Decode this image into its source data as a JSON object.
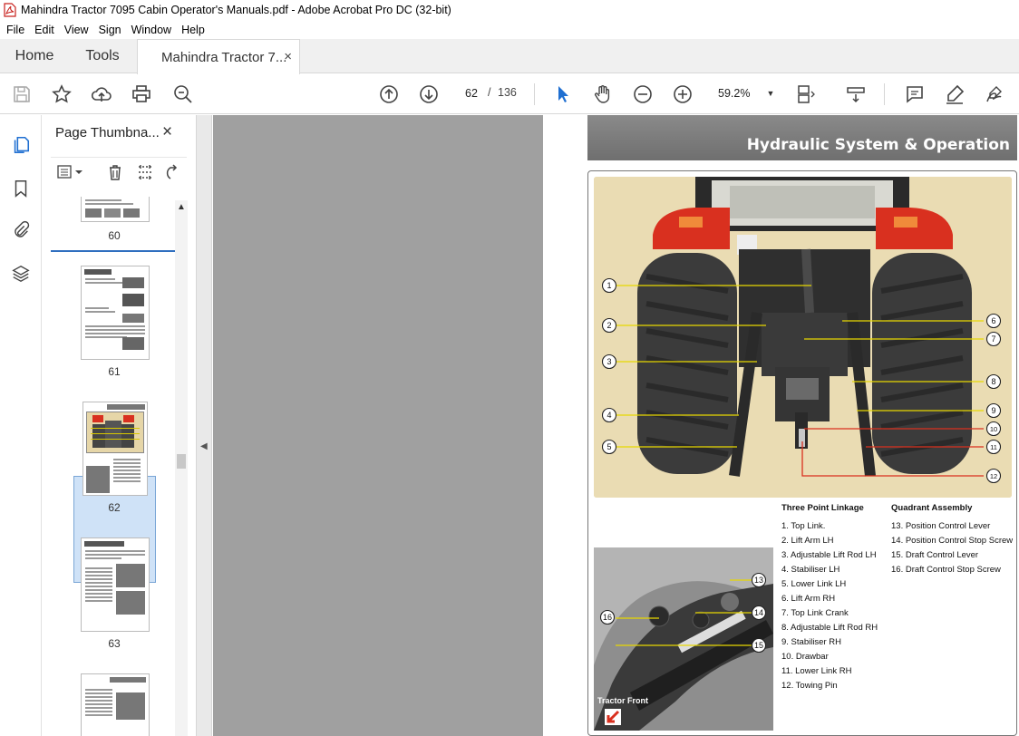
{
  "window": {
    "title": "Mahindra Tractor 7095 Cabin Operator's Manuals.pdf - Adobe Acrobat Pro DC (32-bit)"
  },
  "menu": [
    "File",
    "Edit",
    "View",
    "Sign",
    "Window",
    "Help"
  ],
  "tabs": {
    "home": "Home",
    "tools": "Tools",
    "document": "Mahindra Tractor 7...",
    "close_glyph": "×"
  },
  "toolbar": {
    "current_page": "62",
    "page_sep": "/",
    "total_pages": "136",
    "zoom": "59.2%",
    "icons": [
      "save-icon",
      "star-icon",
      "upload-icon",
      "print-icon",
      "search-zoom-icon",
      "page-up-icon",
      "page-down-icon",
      "select-cursor-icon",
      "hand-icon",
      "zoom-out-icon",
      "zoom-in-icon",
      "fit-width-icon",
      "scroll-mode-icon",
      "comment-icon",
      "highlight-pen-icon",
      "sign-icon"
    ]
  },
  "thumbnail_panel": {
    "title": "Page Thumbna...",
    "close_glyph": "×",
    "thumbnails": [
      {
        "label": "60"
      },
      {
        "label": "61"
      },
      {
        "label": "62",
        "selected": true
      },
      {
        "label": "63"
      },
      {
        "label": ""
      }
    ]
  },
  "page": {
    "header": "Hydraulic System & Operation",
    "callouts_main": [
      "1",
      "2",
      "3",
      "4",
      "5",
      "6",
      "7",
      "8",
      "9",
      "10",
      "11",
      "12"
    ],
    "callouts_lower": [
      "13",
      "14",
      "15",
      "16"
    ],
    "lower_image_caption": "Tractor Front",
    "three_point": {
      "heading": "Three Point Linkage",
      "items": [
        "1.  Top Link.",
        "2.  Lift Arm LH",
        "3.  Adjustable Lift Rod LH",
        "4.  Stabiliser LH",
        "5.  Lower Link LH",
        "6.  Lift Arm RH",
        "7.  Top Link Crank",
        "8.  Adjustable Lift Rod RH",
        "9.  Stabiliser RH",
        "10. Drawbar",
        "11. Lower Link RH",
        "12. Towing Pin"
      ]
    },
    "quadrant": {
      "heading": "Quadrant Assembly",
      "items": [
        "13. Position Control Lever",
        "14. Position Control Stop Screw",
        "15. Draft Control Lever",
        "16. Draft Control Stop Screw"
      ]
    }
  },
  "colors": {
    "accent": "#2f6fbf",
    "doc_bg": "#a0a0a0",
    "header_gray": "#7a7a7a",
    "tractor_red": "#d9301f",
    "callout_line": "#e8d800"
  }
}
